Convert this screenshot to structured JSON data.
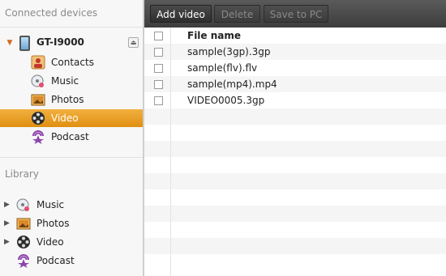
{
  "sidebar": {
    "connected_header": "Connected devices",
    "device": {
      "name": "GT-I9000"
    },
    "device_items": [
      {
        "label": "Contacts"
      },
      {
        "label": "Music"
      },
      {
        "label": "Photos"
      },
      {
        "label": "Video"
      },
      {
        "label": "Podcast"
      }
    ],
    "library_header": "Library",
    "library_items": [
      {
        "label": "Music"
      },
      {
        "label": "Photos"
      },
      {
        "label": "Video"
      },
      {
        "label": "Podcast"
      }
    ]
  },
  "toolbar": {
    "add_video": "Add video",
    "delete": "Delete",
    "save_to_pc": "Save to PC"
  },
  "file_list": {
    "header": "File name",
    "rows": [
      {
        "name": "sample(3gp).3gp"
      },
      {
        "name": "sample(flv).flv"
      },
      {
        "name": "sample(mp4).mp4"
      },
      {
        "name": "VIDEO0005.3gp"
      }
    ]
  },
  "colors": {
    "active": "#e89c20",
    "toolbar": "#444444"
  }
}
